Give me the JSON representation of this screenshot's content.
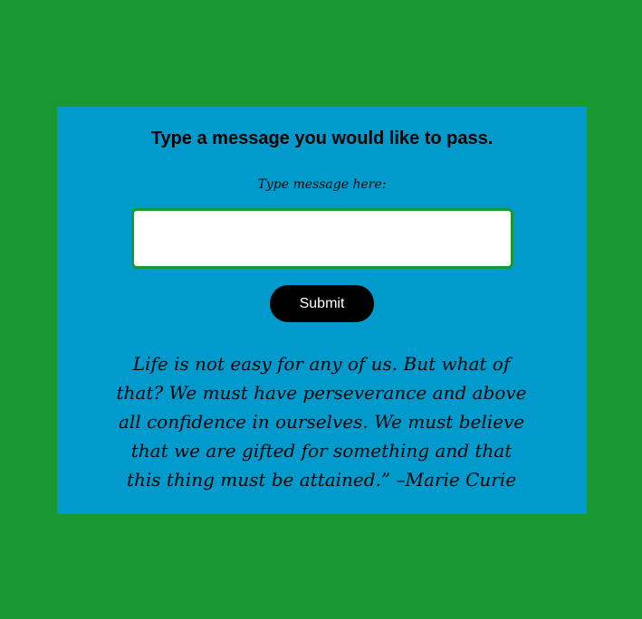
{
  "page": {
    "background_color": "#1a9932",
    "card_color": "#009bcc"
  },
  "form": {
    "heading": "Type a message you would like to pass.",
    "field_label": "Type message here:",
    "input_value": "",
    "input_placeholder": "",
    "submit_label": "Submit"
  },
  "quote": {
    "text": "Life is not easy for any of us. But what of that? We must have perseverance and above all confidence in ourselves. We must believe that we are gifted for something and that this thing must be attained.”  –Marie Curie"
  }
}
